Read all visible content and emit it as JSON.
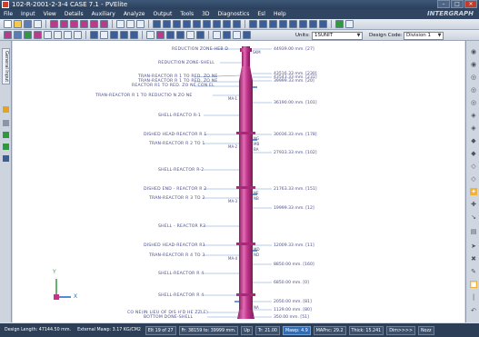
{
  "window": {
    "title": "102-R-2001-2-3-4 CASE 7.1 - PVElite",
    "brand": "INTERGRAPH",
    "controls": [
      "minimize",
      "maximize",
      "close"
    ]
  },
  "menu": [
    "File",
    "Input",
    "View",
    "Details",
    "Auxiliary",
    "Analyze",
    "Output",
    "Tools",
    "3D",
    "Diagnostics",
    "Esl",
    "Help"
  ],
  "toolbar": {
    "units_label": "Units:",
    "units_value": "1SUNIT",
    "design_code_label": "Design Code:",
    "design_code_value": "Division 1"
  },
  "left_panel": {
    "tab_label": "General Input"
  },
  "drawing": {
    "labels_left": [
      "REDUCTION ZONE-HEB D",
      "REDUCTION ZONE-SHELL",
      "TRAN-REACTOR R 1 TO RED. ZO NE",
      "TRAN-REACTOR R 1 TO RED. ZO NE",
      "REACTOR R1 TO RED. ZO NE CON EL",
      "TRAN-REACTOR R 1 TO REDUCTIO N ZO NE",
      "SHELL-REACTO R-1",
      "DISHED HEAD-REACTOR R 1",
      "TRAN-REACTOR R 2 TO 1",
      "SHELL-REACTOR R-2",
      "DISHED END - REACTOR R 2",
      "TRAN-REACTOR R 3 TO 2",
      "SHELL - REACTOR R3",
      "DISHED HEAD-REACTOR R3",
      "TRAN-REACTOR R 4 TO 3",
      "SHELL-REACTOR R 4",
      "SHELL-REACTOR R 4",
      "CO NE(IN LIEU OF DIS H'D HE ZZLE)",
      "BOTTOM DONE-SHELL"
    ],
    "elevations": [
      "44939.00 mm. [27]",
      "43516.33 mm. [230]",
      "43543.33 mm. [231]",
      "39999.33 mm. [20]",
      "36190.00 mm. [101]",
      "30036.33 mm. [178]",
      "27933.33 mm. [102]",
      "21763.33 mm. [151]",
      "19999.33 mm. [12]",
      "12009.33 mm. [11]",
      "8850.00 mm. [160]",
      "6850.00 mm. [0]",
      "2050.00 mm. [81]",
      "1129.00 mm. [80]",
      "350.00 mm. [51]"
    ],
    "tags": [
      "SKM",
      "MA-1",
      "MA-2",
      "MA-3",
      "MA-4",
      "NG",
      "MB",
      "BA",
      "NE",
      "NB",
      "MD",
      "ND",
      "NA"
    ],
    "axis_labels": {
      "y": "Y",
      "x": "X"
    }
  },
  "status_bar": [
    "Design Length: 47144.50 mm.",
    "External Mawp: 3.17 KG/CM2",
    "Elt 19 of 27",
    "Fr: 38159 to: 39999 mm.",
    "Up",
    "Tr: 21.00",
    "Mawp: 4.9",
    "MAPnc: 29.2",
    "Thick: 15.241",
    "Dim>>>>",
    "Nozz"
  ],
  "colors": {
    "vessel": "#c0358a",
    "vessel_highlight": "#e26db5",
    "leader": "#6a9bd0",
    "label": "#4a4c8c",
    "statusbar": "#2d3e57",
    "titlebar": "#2a3f5c"
  }
}
